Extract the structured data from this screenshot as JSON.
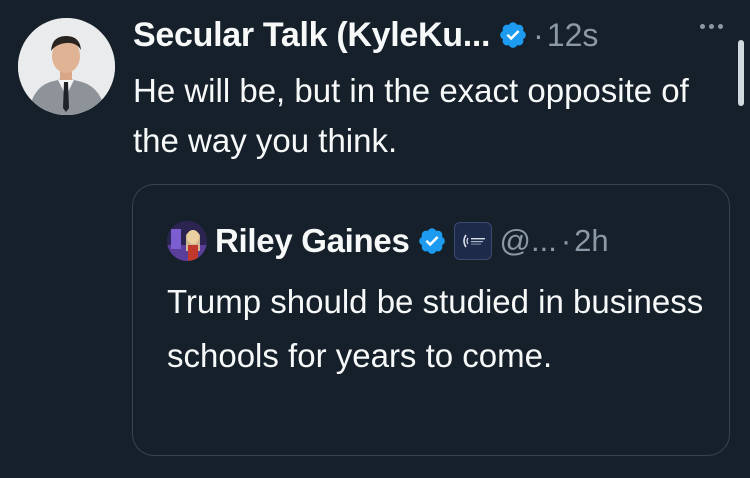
{
  "tweet": {
    "display_name": "Secular Talk (KyleKu...",
    "separator": "·",
    "time": "12s",
    "text": "He will be, but in the exact opposite of the way you think.",
    "verified_icon": "verified-badge-icon",
    "more_icon": "more-options-icon"
  },
  "quote": {
    "display_name": "Riley Gaines",
    "handle": "@...",
    "separator": "·",
    "time": "2h",
    "text": "Trump should be studied in business schools for years to come.",
    "verified_icon": "verified-badge-icon",
    "affiliate_icon": "organization-affiliate-badge"
  },
  "colors": {
    "background": "#15202b",
    "text": "#f7f9f9",
    "secondary_text": "#8b98a5",
    "verified": "#1d9bf0",
    "border": "#38444d"
  }
}
